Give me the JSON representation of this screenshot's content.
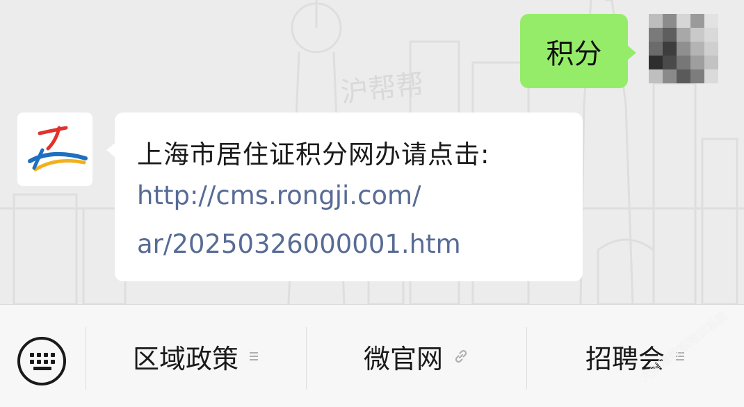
{
  "chat": {
    "outgoing_message": "积分",
    "incoming_message": {
      "line1": "上海市居住证积分网办请点击:",
      "link_line1": "http://cms.rongji.com/",
      "link_line2": "ar/20250326000001.htm"
    },
    "background_sign_text": "沪帮帮"
  },
  "menu": {
    "items": [
      {
        "label": "区域政策",
        "icon": "submenu-lines-icon"
      },
      {
        "label": "微官网",
        "icon": "link-icon"
      },
      {
        "label": "招聘会",
        "icon": "submenu-lines-icon"
      }
    ]
  },
  "watermark": "大美隆教职培训系统",
  "colors": {
    "outgoing_bubble": "#95ec69",
    "link": "#576b95",
    "chat_background": "#ececec",
    "menu_background": "#f7f7f7"
  }
}
